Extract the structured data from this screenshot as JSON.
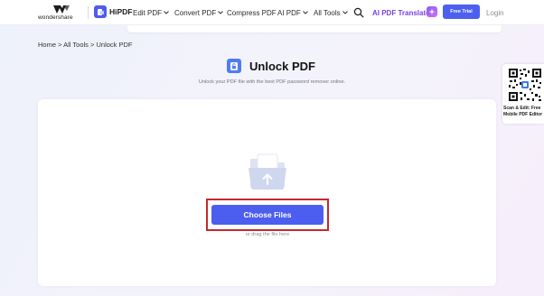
{
  "header": {
    "brand": "wondershare",
    "product": "HiPDF",
    "menu": [
      {
        "label": "Edit PDF",
        "has_dropdown": true
      },
      {
        "label": "Convert PDF",
        "has_dropdown": true
      },
      {
        "label": "Compress PDF",
        "has_dropdown": false
      },
      {
        "label": "AI PDF",
        "has_dropdown": true
      },
      {
        "label": "All Tools",
        "has_dropdown": true
      }
    ],
    "ai_translator": "AI PDF Translator",
    "free_trial": "Free Trial",
    "login": "Login"
  },
  "breadcrumb": "Home > All Tools > Unlock PDF",
  "page": {
    "title": "Unlock PDF",
    "subtitle": "Unlock your PDF file with the best PDF password remover online."
  },
  "upload": {
    "button_label": "Choose Files",
    "drag_hint": "or drag the file here"
  },
  "qr_widget": {
    "line1": "Scan & Edit: Free",
    "line2": "Mobile PDF Editor"
  },
  "colors": {
    "accent": "#4c5ef0",
    "highlight_border": "#c6282d",
    "ai_purple": "#7a3fe0"
  }
}
